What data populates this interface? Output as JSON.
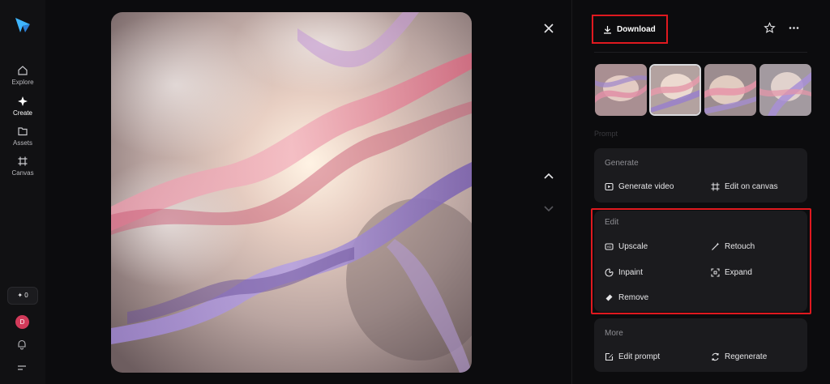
{
  "sidebar": {
    "items": [
      {
        "label": "Explore",
        "icon": "home-icon"
      },
      {
        "label": "Create",
        "icon": "sparkle-icon"
      },
      {
        "label": "Assets",
        "icon": "folder-icon"
      },
      {
        "label": "Canvas",
        "icon": "frame-icon"
      }
    ],
    "credits": "✦ 0",
    "avatar_initial": "D"
  },
  "toolbar": {
    "download_label": "Download"
  },
  "faded_label": "Prompt",
  "generate": {
    "title": "Generate",
    "generate_video": "Generate video",
    "edit_on_canvas": "Edit on canvas"
  },
  "edit": {
    "title": "Edit",
    "upscale": "Upscale",
    "retouch": "Retouch",
    "inpaint": "Inpaint",
    "expand": "Expand",
    "remove": "Remove"
  },
  "more": {
    "title": "More",
    "edit_prompt": "Edit prompt",
    "regenerate": "Regenerate"
  },
  "colors": {
    "highlight": "#e0191f",
    "panel_bg": "#1b1b1e",
    "background": "#0c0c0e",
    "accent_logo": "#3fb6ff"
  }
}
